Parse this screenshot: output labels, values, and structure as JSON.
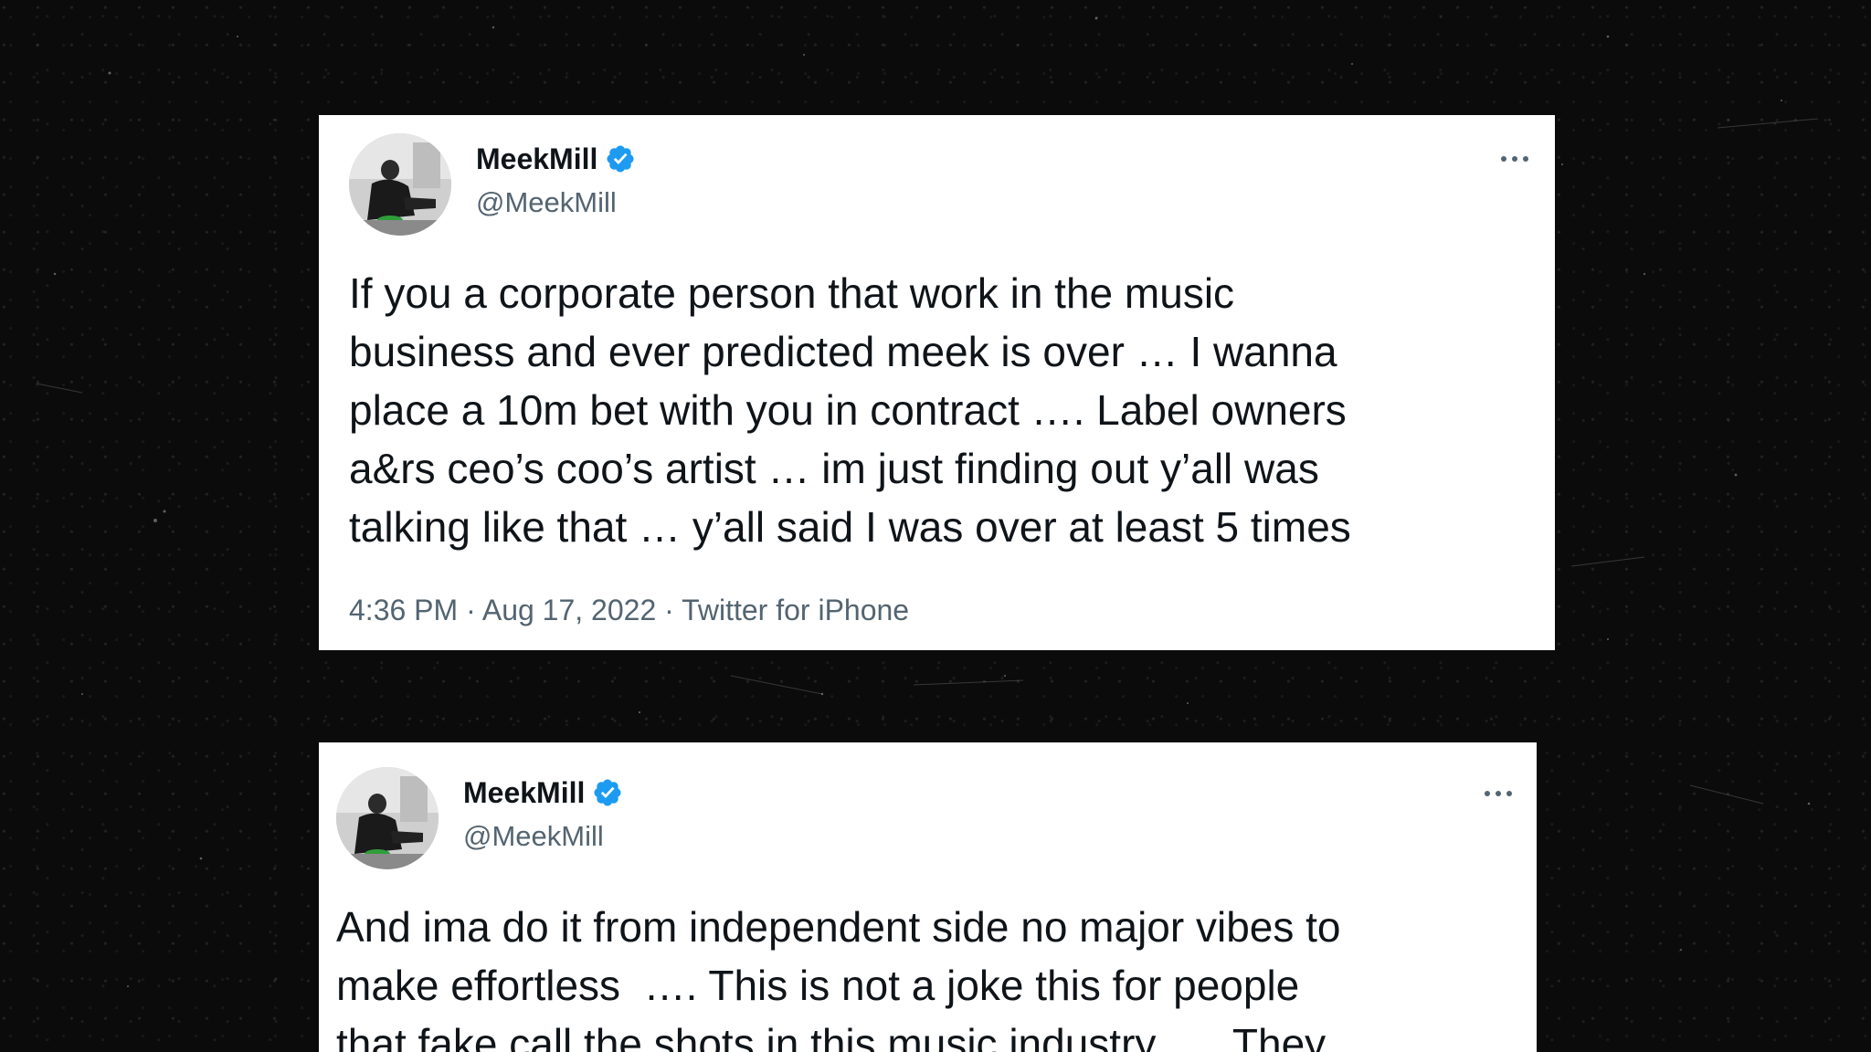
{
  "tweets": [
    {
      "display_name": "MeekMill",
      "handle": "@MeekMill",
      "verified_icon": "verified-badge-icon",
      "text": "If you a corporate person that work in the music\nbusiness and ever predicted meek is over … I wanna\nplace a 10m bet with you in contract …. Label owners\na&rs ceo’s coo’s artist … im just finding out y’all was\ntalking like that … y’all said I was over at least 5 times",
      "time": "4:36 PM",
      "date": "Aug 17, 2022",
      "source": "Twitter for iPhone",
      "separator": " · "
    },
    {
      "display_name": "MeekMill",
      "handle": "@MeekMill",
      "verified_icon": "verified-badge-icon",
      "text": "And ima do it from independent side no major vibes to\nmake effortless  …. This is not a joke this for people\nthat fake call the shots in this music industry …. They"
    }
  ],
  "colors": {
    "background": "#0b0b0b",
    "card": "#ffffff",
    "text_primary": "#0f1419",
    "text_secondary": "#536471",
    "verified_blue": "#1d9bf0"
  }
}
